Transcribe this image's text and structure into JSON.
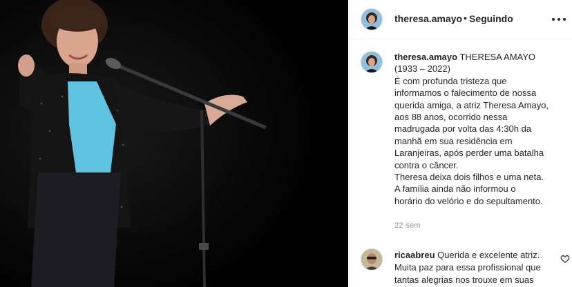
{
  "post": {
    "author": "theresa.amayo",
    "follow_status": "Seguindo",
    "separator": "•",
    "caption": {
      "username": "theresa.amayo",
      "lines": [
        "THERESA AMAYO",
        "(1933 – 2022)",
        "É com profunda tristeza que",
        "informamos o falecimento de nossa",
        "querida amiga, a atriz Theresa Amayo,",
        "aos 88 anos, ocorrido nessa",
        "madrugada por volta das 4:30h da",
        "manhã em sua residência em",
        "Laranjeiras, após perder uma batalha",
        "contra o câncer.",
        "Theresa deixa dois filhos e uma neta.",
        "A família ainda não informou o",
        "horário do velório e do sepultamento."
      ]
    },
    "timestamp": "22 sem"
  },
  "comment": {
    "username": "ricaabreu",
    "lines": [
      "Querida e excelente atriz.",
      "Muita paz para essa profissional que",
      "tantas alegrias nos trouxe em suas"
    ]
  },
  "icons": {
    "more": "more-options-icon",
    "like": "heart-icon"
  },
  "colors": {
    "photo_background": "#050505",
    "text": "#262626",
    "muted": "#8e8e8e",
    "blouse": "#5fc3df"
  }
}
